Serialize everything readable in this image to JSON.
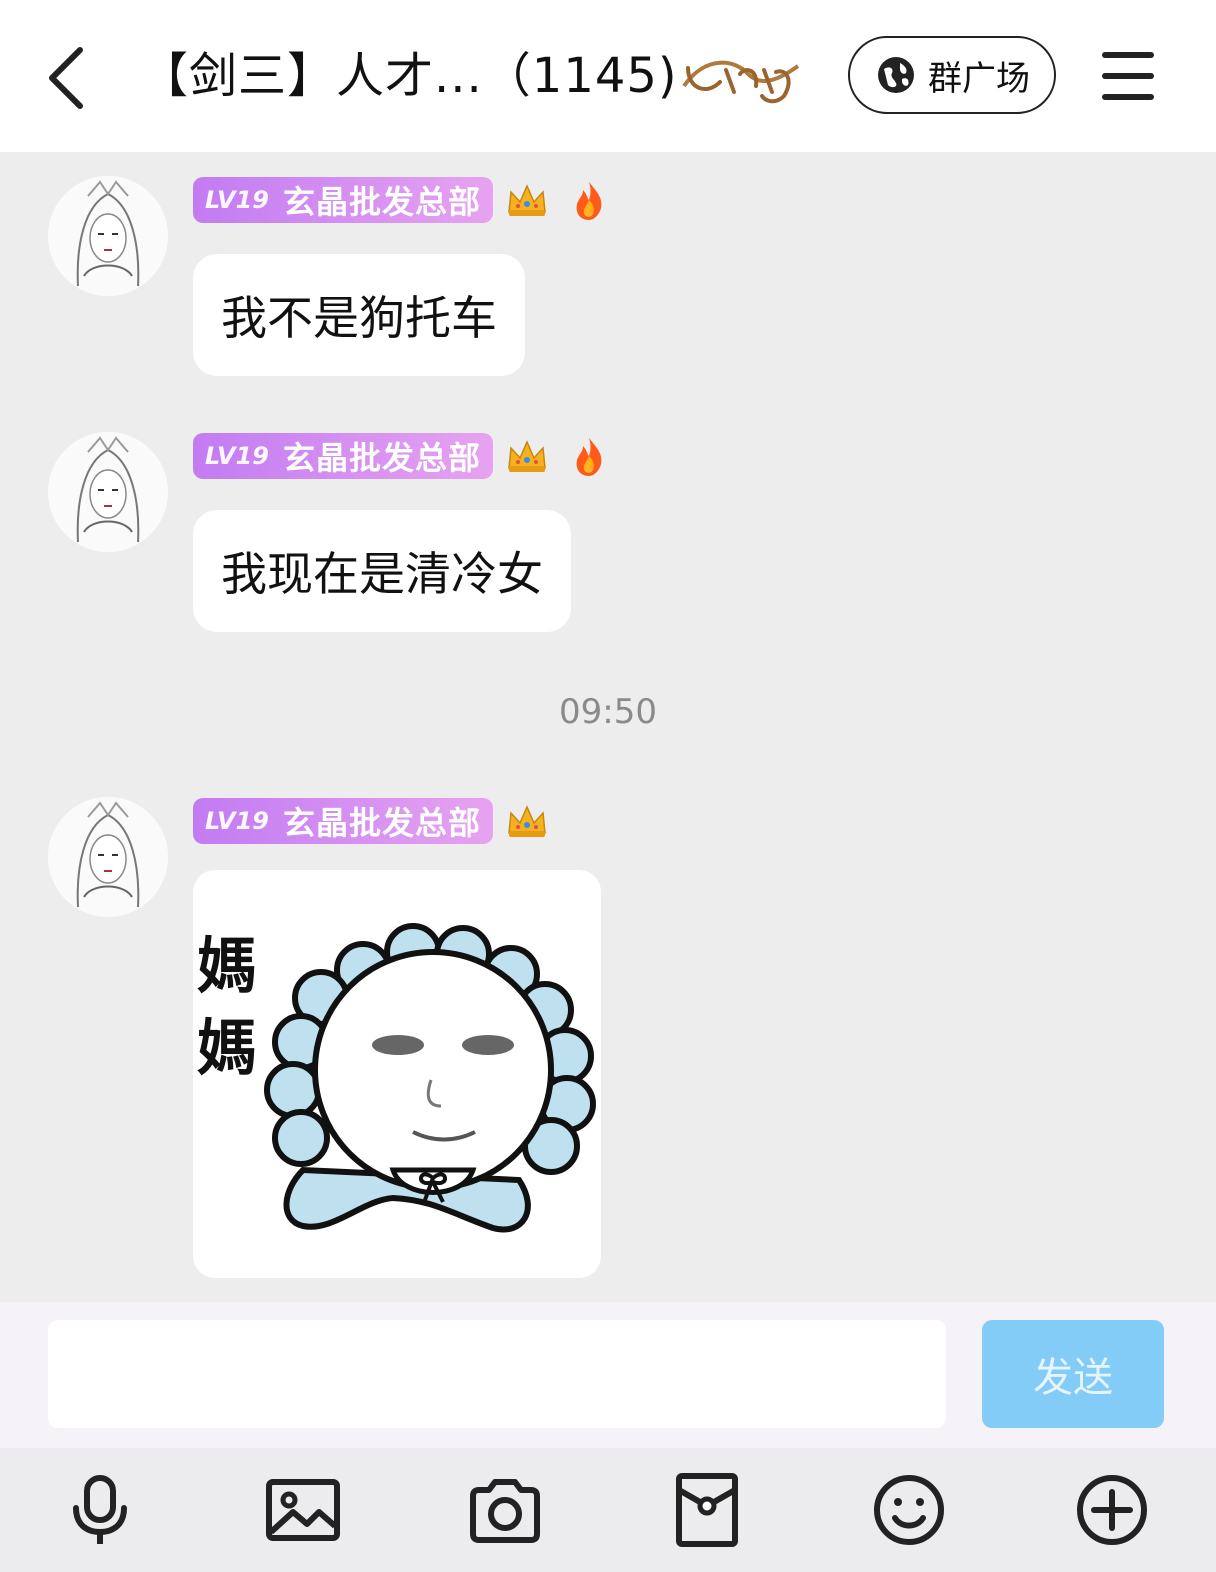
{
  "header": {
    "title": "【剑三】人才...（1145)",
    "square_label": "群广场"
  },
  "messages": [
    {
      "type": "text",
      "level": "LV19",
      "nickname": "玄晶批发总部",
      "text": "我不是狗托车"
    },
    {
      "type": "text",
      "level": "LV19",
      "nickname": "玄晶批发总部",
      "text": "我现在是清冷女"
    },
    {
      "type": "time",
      "text": "09:50"
    },
    {
      "type": "sticker",
      "level": "LV19",
      "nickname": "玄晶批发总部",
      "sticker_text": "媽媽"
    }
  ],
  "input": {
    "value": "",
    "placeholder": ""
  },
  "send_label": "发送",
  "toolbar": [
    "microphone-icon",
    "image-icon",
    "camera-icon",
    "red-packet-icon",
    "emoji-icon",
    "plus-icon"
  ],
  "colors": {
    "badge": "#c27bf2",
    "send": "#84ccf8",
    "chat_bg": "#ededed"
  }
}
